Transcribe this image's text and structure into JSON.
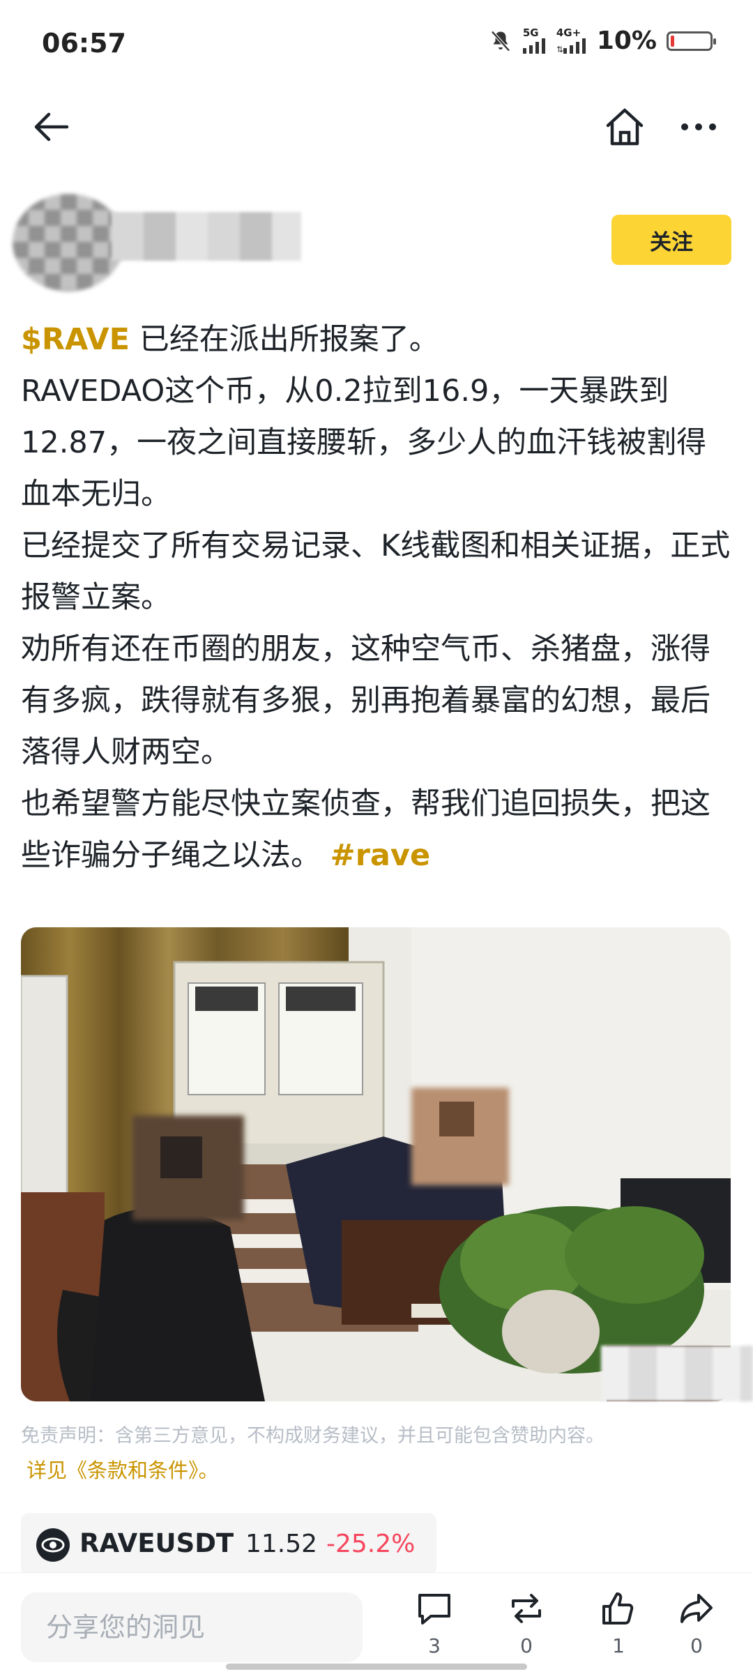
{
  "status_bar": {
    "time": "06:57",
    "network1": "5G",
    "network2": "4G+",
    "battery_percent": "10%",
    "battery_level": 0.1,
    "icons": [
      "mute-bell-icon",
      "signal-icon",
      "battery-icon"
    ]
  },
  "nav": {
    "icons": [
      "back-arrow-icon",
      "home-icon",
      "more-dots-icon"
    ]
  },
  "author": {
    "follow_label": "关注"
  },
  "post": {
    "line1_cashtag": "$RAVE",
    "line1_text": " 已经在派出所报案了。",
    "para2": "RAVEDAO这个币，从0.2拉到16.9，一天暴跌到12.87，一夜之间直接腰斩，多少人的血汗钱被割得血本无归。",
    "para3": "已经提交了所有交易记录、K线截图和相关证据，正式报警立案。",
    "para4": "劝所有还在币圈的朋友，这种空气币、杀猪盘，涨得有多疯，跌得就有多狠，别再抱着暴富的幻想，最后落得人财两空。",
    "para5_text": "也希望警方能尽快立案侦查，帮我们追回损失，把这些诈骗分子绳之以法。",
    "para5_hashtag": "#rave"
  },
  "disclaimer": {
    "text": "免责声明：含第三方意见，不构成财务建议，并且可能包含赞助内容。",
    "link": "详见《条款和条件》。"
  },
  "ticker": {
    "symbol": "RAVEUSDT",
    "price": "11.52",
    "change": "-25.2%"
  },
  "bottom_bar": {
    "comment_placeholder": "分享您的洞见",
    "comments": "3",
    "reposts": "0",
    "likes": "1",
    "shares": "0"
  },
  "colors": {
    "accent": "#fcd535",
    "link": "#c99400",
    "negative": "#f6465d"
  }
}
